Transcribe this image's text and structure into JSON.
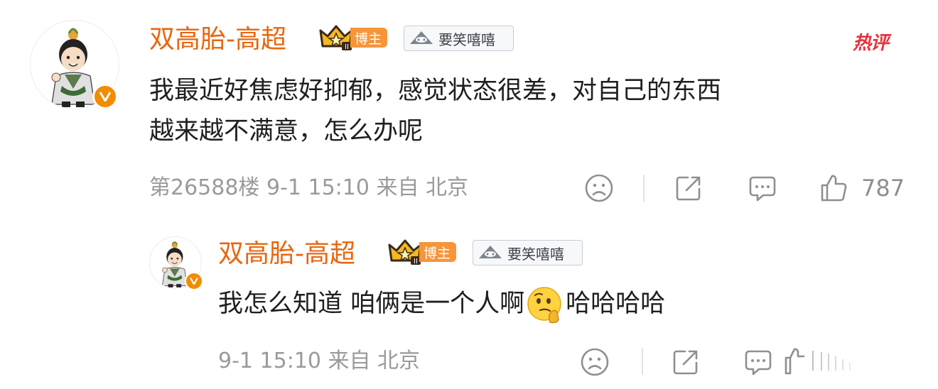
{
  "hot_tag": "热评",
  "comment": {
    "username": "双高胎-高超",
    "role_badge": "博主",
    "fan_badge": "要笑嘻嘻",
    "text_line1": "我最近好焦虑好抑郁，感觉状态很差，对自己的东西",
    "text_line2": "越来越不满意，怎么办呢",
    "meta": "第26588楼 9-1 15:10 来自 北京",
    "like_count": "787"
  },
  "reply": {
    "username": "双高胎-高超",
    "role_badge": "博主",
    "fan_badge": "要笑嘻嘻",
    "text_before": "我怎么知道 咱俩是一个人啊",
    "text_after": "哈哈哈哈",
    "meta": "9-1 15:10 来自 北京"
  },
  "colors": {
    "username": "#e8660f",
    "hot_tag": "#e8313c",
    "meta": "#9a9a9a",
    "text": "#1f1f1f",
    "verified_badge": "#f28c00"
  },
  "icons": [
    "sad-face-icon",
    "share-icon",
    "comment-icon",
    "like-icon",
    "verified-v-icon",
    "crown-icon",
    "fan-badge-icon",
    "thinking-emoji"
  ]
}
